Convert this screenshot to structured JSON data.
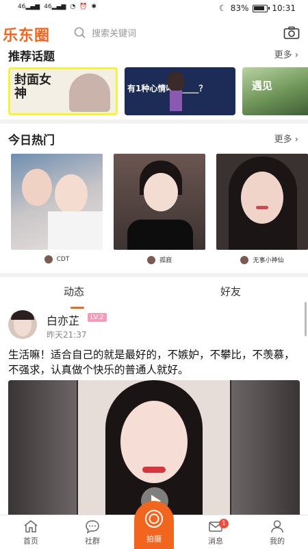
{
  "status_bar": {
    "network1": "46",
    "network2": "46",
    "battery_percent": "83%",
    "time": "10:31"
  },
  "header": {
    "logo": "乐东圈",
    "search_placeholder": "搜索关键词"
  },
  "topics": {
    "title": "推荐话题",
    "more": "更多",
    "cards": [
      {
        "text": "封面女神"
      },
      {
        "text": "有1种心情叫做____？"
      },
      {
        "text": "遇见"
      }
    ]
  },
  "hot": {
    "title": "今日热门",
    "more": "更多",
    "items": [
      {
        "user": "CDT"
      },
      {
        "user": "孤寂"
      },
      {
        "user": "无事小神仙"
      }
    ]
  },
  "feed": {
    "tabs": [
      "动态",
      "好友"
    ],
    "post": {
      "name": "白亦芷",
      "level": "LV.2",
      "time": "昨天21:37",
      "text": "生活嘛！适合自己的就是最好的，不嫉妒，不攀比，不羡慕，不强求，认真做个快乐的普通人就好。"
    }
  },
  "bottom_nav": {
    "items": [
      {
        "label": "首页",
        "icon": "home-icon"
      },
      {
        "label": "社群",
        "icon": "chat-icon"
      },
      {
        "label": "拍摄",
        "icon": "camera-shoot-icon"
      },
      {
        "label": "消息",
        "icon": "mail-icon"
      },
      {
        "label": "我的",
        "icon": "user-icon"
      }
    ],
    "message_badge": "1"
  },
  "colors": {
    "accent": "#f2651e",
    "badge": "#f24b3e",
    "level": "#f59ab8"
  }
}
